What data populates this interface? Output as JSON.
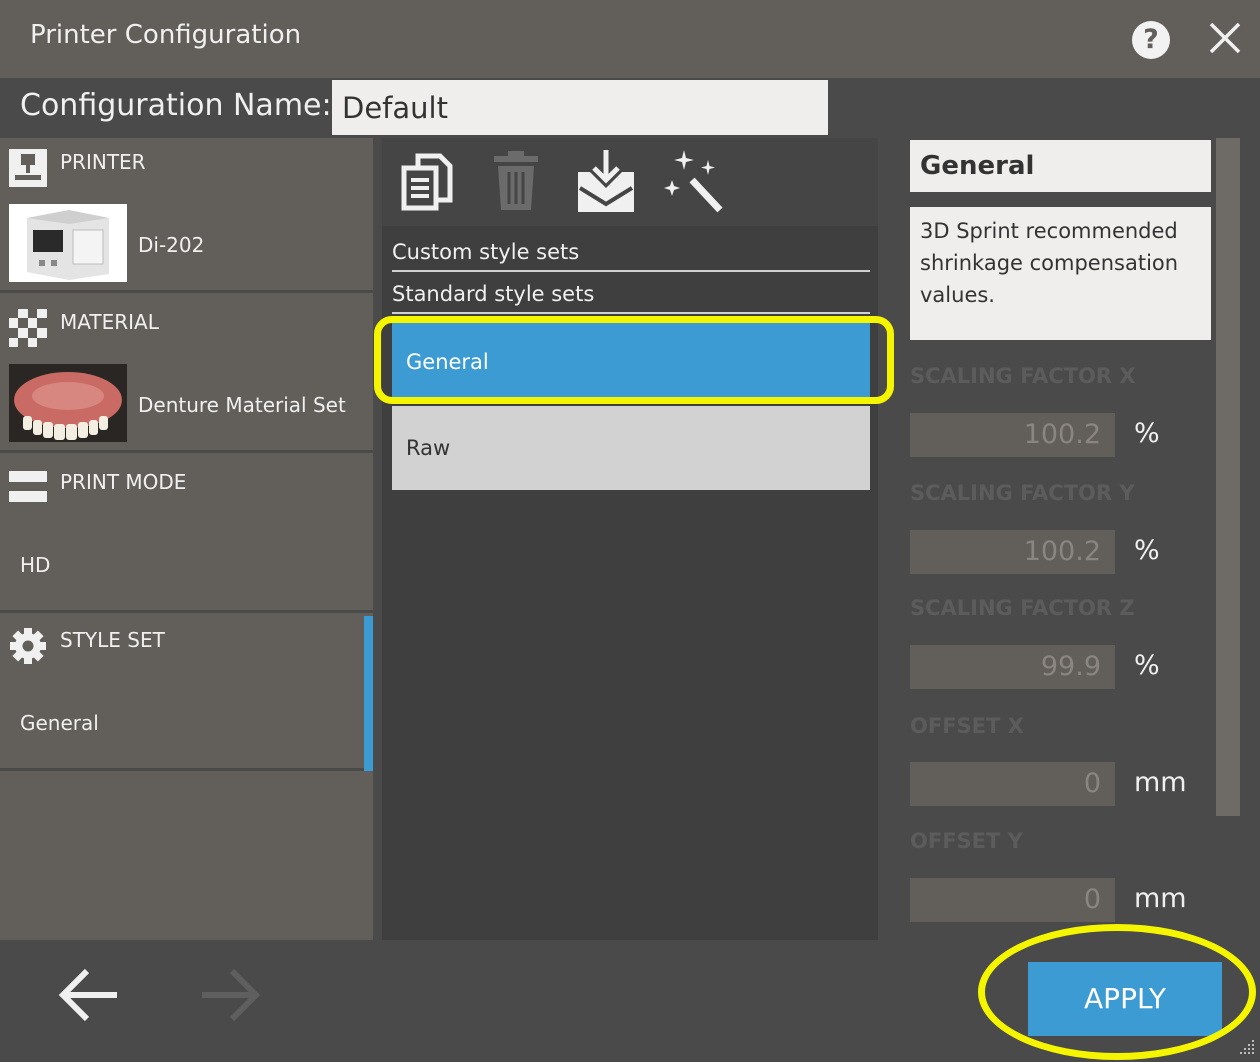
{
  "window": {
    "title": "Printer Configuration"
  },
  "config": {
    "label": "Configuration Name:",
    "value": "Default"
  },
  "sidebar": {
    "sections": [
      {
        "title": "PRINTER",
        "value": "Di-202"
      },
      {
        "title": "MATERIAL",
        "value": "Denture Material Set"
      },
      {
        "title": "PRINT MODE",
        "value": "HD"
      },
      {
        "title": "STYLE SET",
        "value": "General"
      }
    ]
  },
  "styleList": {
    "groups": [
      "Custom style sets",
      "Standard style sets"
    ],
    "items": [
      {
        "label": "General",
        "selected": true
      },
      {
        "label": "Raw",
        "selected": false
      }
    ]
  },
  "details": {
    "name": "General",
    "description": "3D Sprint recommended shrinkage compensation values.",
    "fields": [
      {
        "label": "SCALING FACTOR X",
        "value": "100.2",
        "unit": "%"
      },
      {
        "label": "SCALING FACTOR Y",
        "value": "100.2",
        "unit": "%"
      },
      {
        "label": "SCALING FACTOR Z",
        "value": "99.9",
        "unit": "%"
      },
      {
        "label": "OFFSET X",
        "value": "0",
        "unit": "mm"
      },
      {
        "label": "OFFSET Y",
        "value": "0",
        "unit": "mm"
      }
    ]
  },
  "footer": {
    "apply": "APPLY"
  },
  "colors": {
    "accent": "#3d9bd3",
    "highlight": "#f5f500",
    "panel": "#625e5a",
    "background": "#4a4a4a"
  }
}
